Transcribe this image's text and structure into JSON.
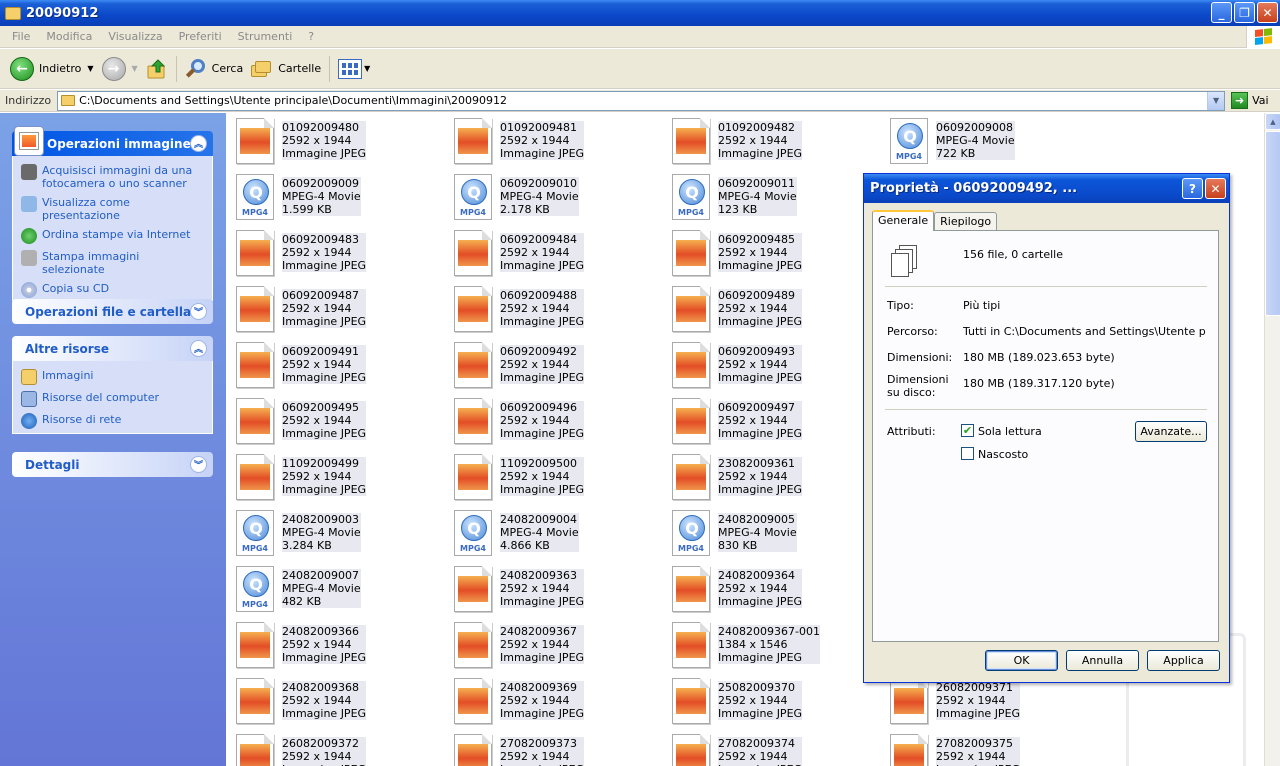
{
  "window": {
    "title": "20090912"
  },
  "menu": [
    "File",
    "Modifica",
    "Visualizza",
    "Preferiti",
    "Strumenti",
    "?"
  ],
  "toolbar": {
    "back": "Indietro",
    "search": "Cerca",
    "folders": "Cartelle"
  },
  "address": {
    "label": "Indirizzo",
    "path": "C:\\Documents and Settings\\Utente principale\\Documenti\\Immagini\\20090912",
    "go": "Vai"
  },
  "left_panel": {
    "image_tasks": {
      "title": "Operazioni immagine",
      "items": [
        "Acquisisci immagini da una fotocamera o uno scanner",
        "Visualizza come presentazione",
        "Ordina stampe via Internet",
        "Stampa immagini selezionate",
        "Copia su CD"
      ]
    },
    "file_tasks": {
      "title": "Operazioni file e cartella"
    },
    "other_places": {
      "title": "Altre risorse",
      "items": [
        "Immagini",
        "Risorse del computer",
        "Risorse di rete"
      ]
    },
    "details": {
      "title": "Dettagli"
    }
  },
  "files": [
    {
      "name": "01092009480",
      "l2": "2592 x 1944",
      "l3": "Immagine JPEG",
      "type": "jpg"
    },
    {
      "name": "01092009481",
      "l2": "2592 x 1944",
      "l3": "Immagine JPEG",
      "type": "jpg"
    },
    {
      "name": "01092009482",
      "l2": "2592 x 1944",
      "l3": "Immagine JPEG",
      "type": "jpg"
    },
    {
      "name": "06092009008",
      "l2": "MPEG-4 Movie",
      "l3": "722 KB",
      "type": "mp4"
    },
    {
      "name": "06092009009",
      "l2": "MPEG-4 Movie",
      "l3": "1.599 KB",
      "type": "mp4"
    },
    {
      "name": "06092009010",
      "l2": "MPEG-4 Movie",
      "l3": "2.178 KB",
      "type": "mp4"
    },
    {
      "name": "06092009011",
      "l2": "MPEG-4 Movie",
      "l3": "123 KB",
      "type": "mp4"
    },
    null,
    {
      "name": "06092009483",
      "l2": "2592 x 1944",
      "l3": "Immagine JPEG",
      "type": "jpg"
    },
    {
      "name": "06092009484",
      "l2": "2592 x 1944",
      "l3": "Immagine JPEG",
      "type": "jpg"
    },
    {
      "name": "06092009485",
      "l2": "2592 x 1944",
      "l3": "Immagine JPEG",
      "type": "jpg"
    },
    null,
    {
      "name": "06092009487",
      "l2": "2592 x 1944",
      "l3": "Immagine JPEG",
      "type": "jpg"
    },
    {
      "name": "06092009488",
      "l2": "2592 x 1944",
      "l3": "Immagine JPEG",
      "type": "jpg"
    },
    {
      "name": "06092009489",
      "l2": "2592 x 1944",
      "l3": "Immagine JPEG",
      "type": "jpg"
    },
    null,
    {
      "name": "06092009491",
      "l2": "2592 x 1944",
      "l3": "Immagine JPEG",
      "type": "jpg"
    },
    {
      "name": "06092009492",
      "l2": "2592 x 1944",
      "l3": "Immagine JPEG",
      "type": "jpg"
    },
    {
      "name": "06092009493",
      "l2": "2592 x 1944",
      "l3": "Immagine JPEG",
      "type": "jpg"
    },
    null,
    {
      "name": "06092009495",
      "l2": "2592 x 1944",
      "l3": "Immagine JPEG",
      "type": "jpg"
    },
    {
      "name": "06092009496",
      "l2": "2592 x 1944",
      "l3": "Immagine JPEG",
      "type": "jpg"
    },
    {
      "name": "06092009497",
      "l2": "2592 x 1944",
      "l3": "Immagine JPEG",
      "type": "jpg"
    },
    null,
    {
      "name": "11092009499",
      "l2": "2592 x 1944",
      "l3": "Immagine JPEG",
      "type": "jpg"
    },
    {
      "name": "11092009500",
      "l2": "2592 x 1944",
      "l3": "Immagine JPEG",
      "type": "jpg"
    },
    {
      "name": "23082009361",
      "l2": "2592 x 1944",
      "l3": "Immagine JPEG",
      "type": "jpg"
    },
    null,
    {
      "name": "24082009003",
      "l2": "MPEG-4 Movie",
      "l3": "3.284 KB",
      "type": "mp4"
    },
    {
      "name": "24082009004",
      "l2": "MPEG-4 Movie",
      "l3": "4.866 KB",
      "type": "mp4"
    },
    {
      "name": "24082009005",
      "l2": "MPEG-4 Movie",
      "l3": "830 KB",
      "type": "mp4"
    },
    null,
    {
      "name": "24082009007",
      "l2": "MPEG-4 Movie",
      "l3": "482 KB",
      "type": "mp4"
    },
    {
      "name": "24082009363",
      "l2": "2592 x 1944",
      "l3": "Immagine JPEG",
      "type": "jpg"
    },
    {
      "name": "24082009364",
      "l2": "2592 x 1944",
      "l3": "Immagine JPEG",
      "type": "jpg"
    },
    null,
    {
      "name": "24082009366",
      "l2": "2592 x 1944",
      "l3": "Immagine JPEG",
      "type": "jpg"
    },
    {
      "name": "24082009367",
      "l2": "2592 x 1944",
      "l3": "Immagine JPEG",
      "type": "jpg"
    },
    {
      "name": "24082009367-001",
      "l2": "1384 x 1546",
      "l3": "Immagine JPEG",
      "type": "jpg"
    },
    null,
    {
      "name": "24082009368",
      "l2": "2592 x 1944",
      "l3": "Immagine JPEG",
      "type": "jpg"
    },
    {
      "name": "24082009369",
      "l2": "2592 x 1944",
      "l3": "Immagine JPEG",
      "type": "jpg"
    },
    {
      "name": "25082009370",
      "l2": "2592 x 1944",
      "l3": "Immagine JPEG",
      "type": "jpg"
    },
    {
      "name": "26082009371",
      "l2": "2592 x 1944",
      "l3": "Immagine JPEG",
      "type": "jpg"
    },
    {
      "name": "26082009372",
      "l2": "2592 x 1944",
      "l3": "Immagine JPEG",
      "type": "jpg"
    },
    {
      "name": "27082009373",
      "l2": "2592 x 1944",
      "l3": "Immagine JPEG",
      "type": "jpg"
    },
    {
      "name": "27082009374",
      "l2": "2592 x 1944",
      "l3": "Immagine JPEG",
      "type": "jpg"
    },
    {
      "name": "27082009375",
      "l2": "2592 x 1944",
      "l3": "Immagine JPEG",
      "type": "jpg"
    }
  ],
  "dialog": {
    "title": "Proprietà - 06092009492, ...",
    "tabs": [
      "Generale",
      "Riepilogo"
    ],
    "summary": "156 file, 0 cartelle",
    "fields": [
      {
        "k": "Tipo:",
        "v": "Più tipi"
      },
      {
        "k": "Percorso:",
        "v": "Tutti in C:\\Documents and Settings\\Utente principale"
      },
      {
        "k": "Dimensioni:",
        "v": "180 MB (189.023.653 byte)"
      },
      {
        "k": "Dimensioni su disco:",
        "v": "180 MB (189.317.120 byte)"
      }
    ],
    "attributes_label": "Attributi:",
    "readonly": "Sola lettura",
    "hidden": "Nascosto",
    "advanced": "Avanzate...",
    "ok": "OK",
    "cancel": "Annulla",
    "apply": "Applica"
  }
}
